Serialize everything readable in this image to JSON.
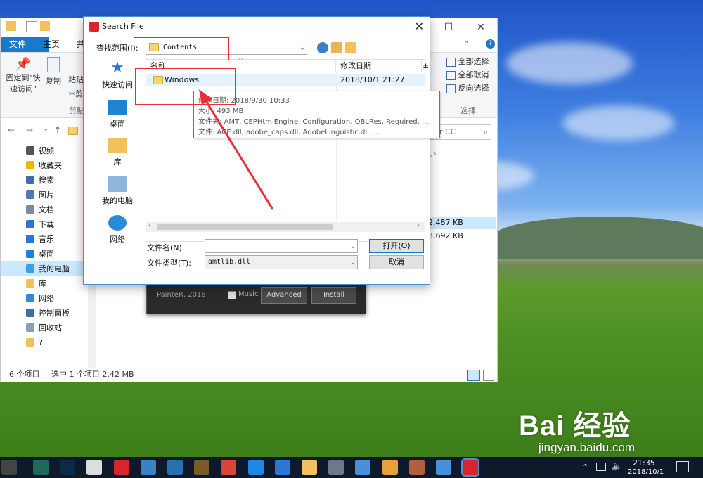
{
  "explorer": {
    "ribbon_tabs": [
      "文件",
      "主页",
      "共"
    ],
    "ribbon_buttons": {
      "pin_line1": "固定到\"快",
      "pin_line2": "速访问\"",
      "copy": "复制",
      "paste": "粘贴",
      "cut": "剪",
      "clipboard_group": "剪贴",
      "select_all": "全部选择",
      "select_none": "全部取消",
      "invert_selection": "反向选择",
      "select_group": "选择"
    },
    "search_placeholder": "tor CC",
    "column_partial": "小",
    "sizes": [
      "2,487 KB",
      "3,692 KB"
    ],
    "sidebar": [
      {
        "label": "视频",
        "icon": "video-icon",
        "color": "#555555"
      },
      {
        "label": "收藏夹",
        "icon": "star-icon",
        "color": "#f5b400"
      },
      {
        "label": "搜索",
        "icon": "search-icon",
        "color": "#3c6db0"
      },
      {
        "label": "图片",
        "icon": "picture-icon",
        "color": "#4a7bb7"
      },
      {
        "label": "文档",
        "icon": "document-icon",
        "color": "#7a8aa0"
      },
      {
        "label": "下载",
        "icon": "download-icon",
        "color": "#2a77d8"
      },
      {
        "label": "音乐",
        "icon": "music-icon",
        "color": "#2a77d8"
      },
      {
        "label": "桌面",
        "icon": "desktop-icon",
        "color": "#1f83d1"
      },
      {
        "label": "我的电脑",
        "icon": "computer-icon",
        "color": "#3aa0e0"
      },
      {
        "label": "库",
        "icon": "library-icon",
        "color": "#f2c15b"
      },
      {
        "label": "网络",
        "icon": "network-icon",
        "color": "#2b8bd8"
      },
      {
        "label": "控制面板",
        "icon": "control-panel-icon",
        "color": "#3b6fb0"
      },
      {
        "label": "回收站",
        "icon": "recycle-bin-icon",
        "color": "#8aa0b5"
      },
      {
        "label": "?",
        "icon": "folder-icon",
        "color": "#f2c15b"
      }
    ],
    "status": {
      "items": "6 个项目",
      "selected": "选中 1 个项目  2.42 MB"
    }
  },
  "installer": {
    "label": "PainteR, 2016",
    "music_label": "Music",
    "advanced": "Advanced",
    "install": "Install"
  },
  "dialog": {
    "title": "Search File",
    "look_in_label": "查找范围(I):",
    "look_in_value": "Contents",
    "places": [
      "快速访问",
      "桌面",
      "库",
      "我的电脑",
      "网络"
    ],
    "columns": {
      "name": "名称",
      "modified": "修改日期",
      "more": "±"
    },
    "files": [
      {
        "name": "Windows",
        "modified": "2018/10/1 21:27"
      }
    ],
    "filename_label": "文件名(N):",
    "filename_value": "",
    "filetype_label": "文件类型(T):",
    "filetype_value": "amtlib.dll",
    "open": "打开(O)",
    "cancel": "取消"
  },
  "tooltip": {
    "line1": "创建日期: 2018/9/30 10:33",
    "line2": "大小: 493 MB",
    "line3": "文件夹: AMT, CEPHtmlEngine, Configuration, OBLRes, Required, ...",
    "line4": "文件: ACE.dll, adobe_caps.dll, AdobeLinguistic.dll, ..."
  },
  "watermark": {
    "brand": "Bai  经验",
    "url": "jingyan.baidu.com"
  },
  "taskbar": {
    "time": "21:35",
    "date": "2018/10/1",
    "apps": [
      "calculator-icon",
      "ai-icon",
      "ps-icon",
      "file-icon",
      "app-red-icon",
      "cloud-icon",
      "photo-icon",
      "archive-icon",
      "chrome-icon",
      "edge-icon",
      "k-icon",
      "folder-icon",
      "monitor-icon",
      "shirt-icon",
      "shield-icon",
      "palette-icon",
      "bird-icon",
      "installer-icon"
    ]
  }
}
